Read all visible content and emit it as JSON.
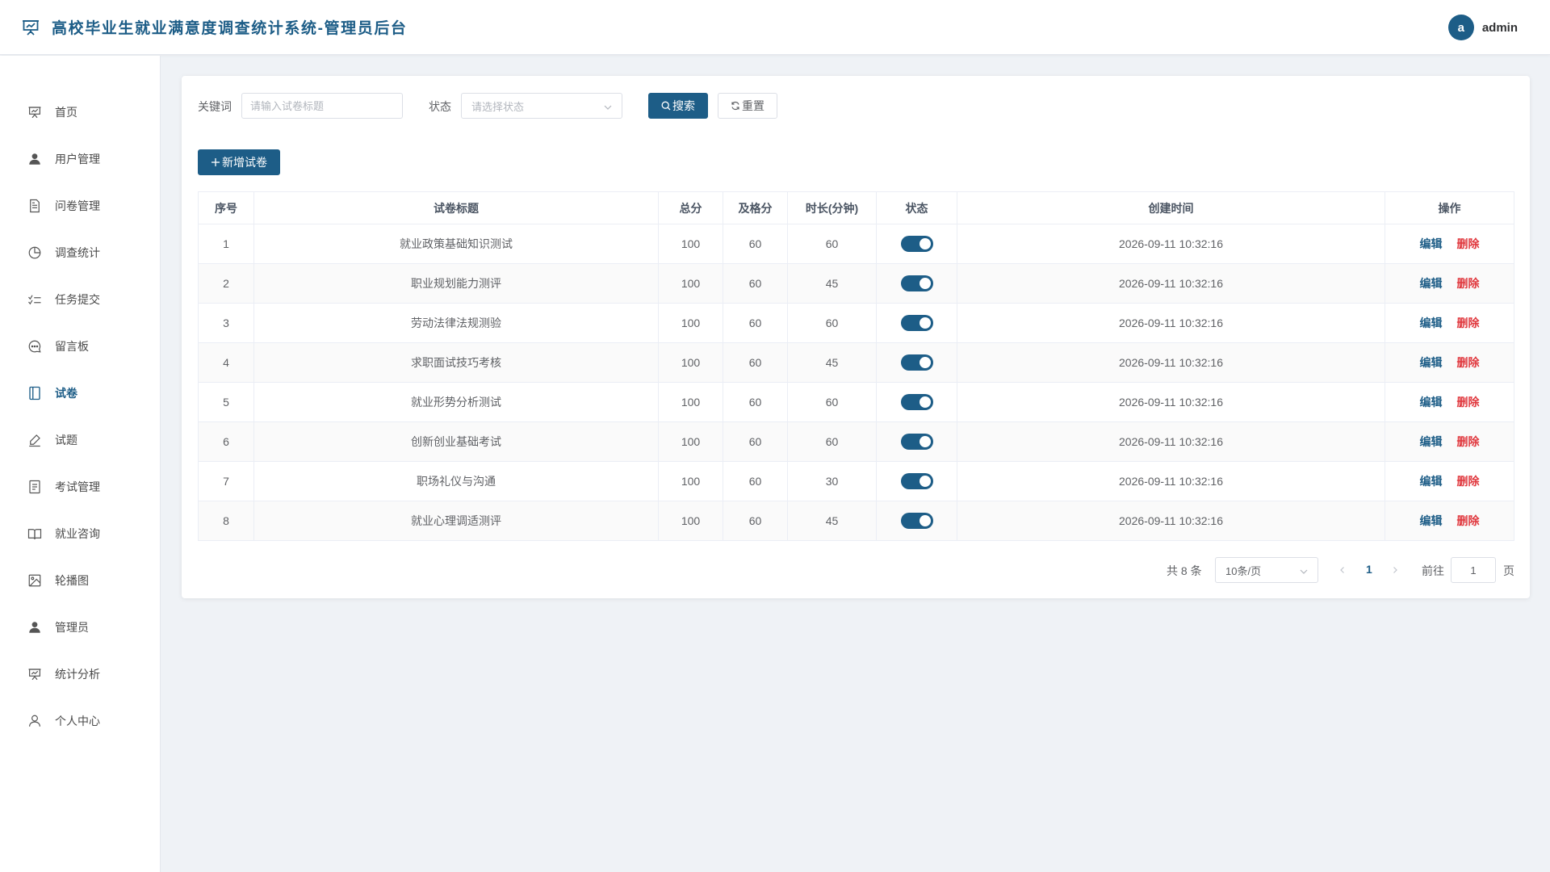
{
  "app": {
    "title": "高校毕业生就业满意度调查统计系统-管理员后台",
    "brand_color": "#1d5d87",
    "logo_icon": "presentation-board-icon"
  },
  "user": {
    "avatar_letter": "a",
    "name": "admin"
  },
  "sidebar": {
    "items": [
      {
        "label": "首页",
        "icon": "presentation-board-icon",
        "active": false
      },
      {
        "label": "用户管理",
        "icon": "user-icon",
        "active": false
      },
      {
        "label": "问卷管理",
        "icon": "document-icon",
        "active": false
      },
      {
        "label": "调查统计",
        "icon": "pie-chart-icon",
        "active": false
      },
      {
        "label": "任务提交",
        "icon": "checklist-icon",
        "active": false
      },
      {
        "label": "留言板",
        "icon": "chat-bubble-icon",
        "active": false
      },
      {
        "label": "试卷",
        "icon": "notebook-icon",
        "active": true
      },
      {
        "label": "试题",
        "icon": "pen-icon",
        "active": false
      },
      {
        "label": "考试管理",
        "icon": "list-document-icon",
        "active": false
      },
      {
        "label": "就业咨询",
        "icon": "open-book-icon",
        "active": false
      },
      {
        "label": "轮播图",
        "icon": "image-icon",
        "active": false
      },
      {
        "label": "管理员",
        "icon": "user-icon",
        "active": false
      },
      {
        "label": "统计分析",
        "icon": "presentation-board-icon",
        "active": false
      },
      {
        "label": "个人中心",
        "icon": "user-outline-icon",
        "active": false
      }
    ]
  },
  "filters": {
    "keyword_label": "关键词",
    "keyword_placeholder": "请输入试卷标题",
    "keyword_value": "",
    "status_label": "状态",
    "status_placeholder": "请选择状态",
    "search_button": "搜索",
    "reset_button": "重置"
  },
  "actions": {
    "add_button": "新增试卷"
  },
  "table": {
    "columns": [
      "序号",
      "试卷标题",
      "总分",
      "及格分",
      "时长(分钟)",
      "状态",
      "创建时间",
      "操作"
    ],
    "edit_label": "编辑",
    "delete_label": "删除",
    "rows": [
      {
        "index": "1",
        "title": "就业政策基础知识测试",
        "total": "100",
        "pass": "60",
        "duration": "60",
        "enabled": true,
        "created": "2026-09-11 10:32:16"
      },
      {
        "index": "2",
        "title": "职业规划能力测评",
        "total": "100",
        "pass": "60",
        "duration": "45",
        "enabled": true,
        "created": "2026-09-11 10:32:16"
      },
      {
        "index": "3",
        "title": "劳动法律法规测验",
        "total": "100",
        "pass": "60",
        "duration": "60",
        "enabled": true,
        "created": "2026-09-11 10:32:16"
      },
      {
        "index": "4",
        "title": "求职面试技巧考核",
        "total": "100",
        "pass": "60",
        "duration": "45",
        "enabled": true,
        "created": "2026-09-11 10:32:16"
      },
      {
        "index": "5",
        "title": "就业形势分析测试",
        "total": "100",
        "pass": "60",
        "duration": "60",
        "enabled": true,
        "created": "2026-09-11 10:32:16"
      },
      {
        "index": "6",
        "title": "创新创业基础考试",
        "total": "100",
        "pass": "60",
        "duration": "60",
        "enabled": true,
        "created": "2026-09-11 10:32:16"
      },
      {
        "index": "7",
        "title": "职场礼仪与沟通",
        "total": "100",
        "pass": "60",
        "duration": "30",
        "enabled": true,
        "created": "2026-09-11 10:32:16"
      },
      {
        "index": "8",
        "title": "就业心理调适测评",
        "total": "100",
        "pass": "60",
        "duration": "45",
        "enabled": true,
        "created": "2026-09-11 10:32:16"
      }
    ]
  },
  "pagination": {
    "total_text": "共 8 条",
    "page_size": "10条/页",
    "current_page": "1",
    "goto_label": "前往",
    "goto_value": "1",
    "page_suffix": "页"
  }
}
